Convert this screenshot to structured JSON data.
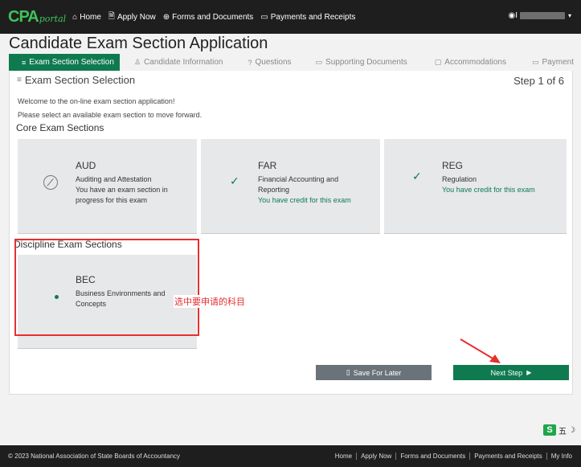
{
  "topbar": {
    "logo_cpa": "CPA",
    "logo_portal": "portal",
    "nav": [
      {
        "label": "Home",
        "icon": "home-icon",
        "glyph": "⌂"
      },
      {
        "label": "Apply Now",
        "icon": "document-icon",
        "glyph": "🗎"
      },
      {
        "label": "Forms and Documents",
        "icon": "globe-icon",
        "glyph": "⊕"
      },
      {
        "label": "Payments and Receipts",
        "icon": "card-icon",
        "glyph": "▭"
      }
    ],
    "user_initial": "I"
  },
  "page_title": "Candidate Exam Section Application",
  "tabs": [
    {
      "label": "Exam Section Selection",
      "glyph": "≡",
      "active": true
    },
    {
      "label": "Candidate Information",
      "glyph": "♙",
      "active": false
    },
    {
      "label": "Questions",
      "glyph": "?",
      "active": false
    },
    {
      "label": "Supporting Documents",
      "glyph": "▭",
      "active": false
    },
    {
      "label": "Accommodations",
      "glyph": "▢",
      "active": false
    },
    {
      "label": "Payment",
      "glyph": "▭",
      "active": false
    }
  ],
  "section": {
    "heading": "Exam Section Selection",
    "step": "Step 1 of 6",
    "welcome": "Welcome to the on-line exam section application!",
    "instructions": "Please select an available exam section to move forward."
  },
  "core": {
    "title": "Core Exam Sections",
    "items": [
      {
        "code": "AUD",
        "name": "Auditing and Attestation",
        "status_line1": "You have an exam section in",
        "status_line2": "progress for this exam",
        "state": "in-progress"
      },
      {
        "code": "FAR",
        "name_line1": "Financial Accounting and",
        "name_line2": "Reporting",
        "status": "You have credit for this exam",
        "state": "credit"
      },
      {
        "code": "REG",
        "name": "Regulation",
        "status": "You have credit for this exam",
        "state": "credit"
      }
    ]
  },
  "discipline": {
    "title": "Discipline Exam Sections",
    "items": [
      {
        "code": "BEC",
        "name_line1": "Business Environments and",
        "name_line2": "Concepts",
        "state": "selected"
      }
    ]
  },
  "annotation": "选中要申请的科目",
  "buttons": {
    "save": "Save For Later",
    "next": "Next Step"
  },
  "ime": {
    "badge": "S",
    "mode": "五"
  },
  "footer": {
    "copyright": "© 2023 National Association of State Boards of Accountancy",
    "links": [
      "Home",
      "Apply Now",
      "Forms and Documents",
      "Payments and Receipts",
      "My Info"
    ]
  },
  "colors": {
    "accent": "#0f7a50",
    "logo_green": "#3fc25a",
    "annotation_red": "#e53030",
    "topbar": "#1e1e1e"
  }
}
